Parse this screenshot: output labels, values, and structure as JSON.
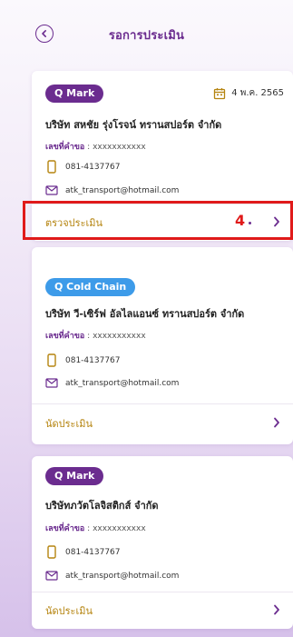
{
  "header": {
    "title": "รอการประเมิน"
  },
  "cards": [
    {
      "badge": "Q Mark",
      "date": "4 พ.ค. 2565",
      "company": "บริษัท สหชัย รุ่งโรจน์ ทรานสปอร์ต จำกัด",
      "request_label": "เลขที่คำขอ",
      "request_value": " : xxxxxxxxxxx",
      "phone": "081-4137767",
      "email": "atk_transport@hotmail.com",
      "action": "ตรวจประเมิน"
    },
    {
      "badge": "Q Cold Chain",
      "company": "บริษัท วี-เซิร์ฟ อัลไลแอนซ์ ทรานสปอร์ต จำกัด",
      "request_label": "เลขที่คำขอ",
      "request_value": " : xxxxxxxxxxx",
      "phone": "081-4137767",
      "email": "atk_transport@hotmail.com",
      "action": "นัดประเมิน"
    },
    {
      "badge": "Q Mark",
      "company": "บริษัทภวัตโลจิสติกส์ จำกัด",
      "request_label": "เลขที่คำขอ",
      "request_value": " : xxxxxxxxxxx",
      "phone": "081-4137767",
      "email": "atk_transport@hotmail.com",
      "action": "นัดประเมิน"
    }
  ],
  "annotation": {
    "step": "4"
  },
  "colors": {
    "primary": "#6b2c8f",
    "badge_blue": "#3d9be9",
    "action_text": "#b5840f",
    "highlight": "#e01a1a"
  }
}
